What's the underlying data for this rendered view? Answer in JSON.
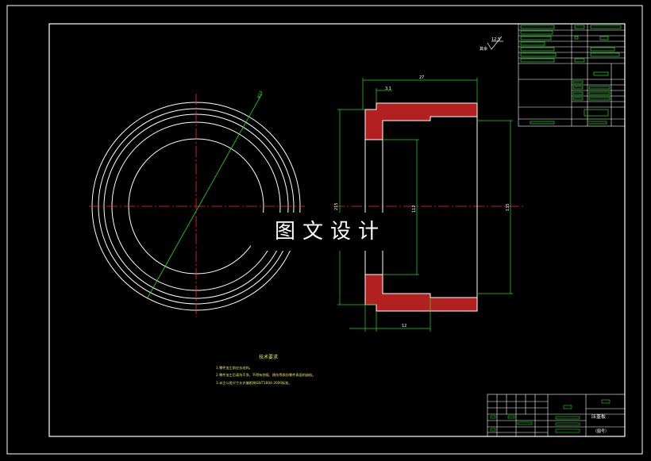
{
  "watermark": "图文设计",
  "notes": {
    "title": "技术要求",
    "lines": [
      "1.零件加工前应去毛刺。",
      "2.零件加工后清洗干净，不得有划痕、擦伤等损伤零件表面的缺陷。",
      "3.未注公差尺寸允许偏差按GB/T1804-2000标准。"
    ]
  },
  "dimensions": {
    "width_top": "27",
    "step": "3.1",
    "bottom": "12",
    "left_dia": "215",
    "mid_dia": "112",
    "right_dia": "135",
    "circle_dia": "φ14"
  },
  "roughness": {
    "value": "12.5",
    "note": "其余"
  },
  "title_block": {
    "part_name": "压盖板",
    "drawing_no": "（图号）"
  },
  "colors": {
    "background": "#000000",
    "frame": "#ffffff",
    "centerline": "#ff2a2a",
    "dimension": "#22dd22",
    "hatch": "#ff3333",
    "text_yellow": "#e8e860"
  }
}
